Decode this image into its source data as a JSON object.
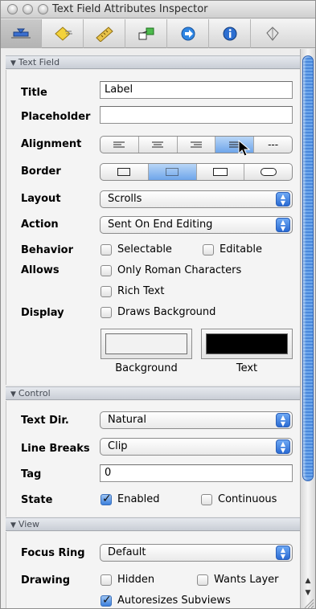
{
  "window": {
    "title": "Text Field Attributes Inspector"
  },
  "toolbar": {
    "tabs": [
      {
        "icon": "attributes-icon",
        "selected": true
      },
      {
        "icon": "effects-icon",
        "selected": false
      },
      {
        "icon": "size-ruler-icon",
        "selected": false
      },
      {
        "icon": "connections-icon",
        "selected": false
      },
      {
        "icon": "bindings-icon",
        "selected": false
      },
      {
        "icon": "identity-icon",
        "selected": false
      },
      {
        "icon": "applescript-icon",
        "selected": false
      }
    ]
  },
  "text_field_section": {
    "header": "Text Field",
    "title_label": "Title",
    "title_value": "Label",
    "placeholder_label": "Placeholder",
    "placeholder_value": "",
    "alignment_label": "Alignment",
    "alignment_options": [
      "left",
      "center",
      "right",
      "justified",
      "natural"
    ],
    "alignment_selected": "justified",
    "alignment_natural_glyph": "---",
    "border_label": "Border",
    "border_options": [
      "line",
      "bezel",
      "square",
      "rounded"
    ],
    "border_selected": "bezel",
    "layout_label": "Layout",
    "layout_value": "Scrolls",
    "action_label": "Action",
    "action_value": "Sent On End Editing",
    "behavior_label": "Behavior",
    "selectable_label": "Selectable",
    "selectable_checked": false,
    "editable_label": "Editable",
    "editable_checked": false,
    "allows_label": "Allows",
    "only_roman_label": "Only Roman Characters",
    "only_roman_checked": false,
    "rich_text_label": "Rich Text",
    "rich_text_checked": false,
    "display_label": "Display",
    "draws_background_label": "Draws Background",
    "draws_background_checked": false,
    "background_well_label": "Background",
    "background_color": "#f2f2f2",
    "text_well_label": "Text",
    "text_color": "#000000"
  },
  "control_section": {
    "header": "Control",
    "text_dir_label": "Text Dir.",
    "text_dir_value": "Natural",
    "line_breaks_label": "Line Breaks",
    "line_breaks_value": "Clip",
    "tag_label": "Tag",
    "tag_value": "0",
    "state_label": "State",
    "enabled_label": "Enabled",
    "enabled_checked": true,
    "continuous_label": "Continuous",
    "continuous_checked": false
  },
  "view_section": {
    "header": "View",
    "focus_ring_label": "Focus Ring",
    "focus_ring_value": "Default",
    "drawing_label": "Drawing",
    "hidden_label": "Hidden",
    "hidden_checked": false,
    "wants_layer_label": "Wants Layer",
    "wants_layer_checked": false,
    "autoresizes_label": "Autoresizes Subviews",
    "autoresizes_checked": true
  },
  "colors": {
    "accent": "#3c7fdc",
    "section_header": "#c9ced6"
  }
}
